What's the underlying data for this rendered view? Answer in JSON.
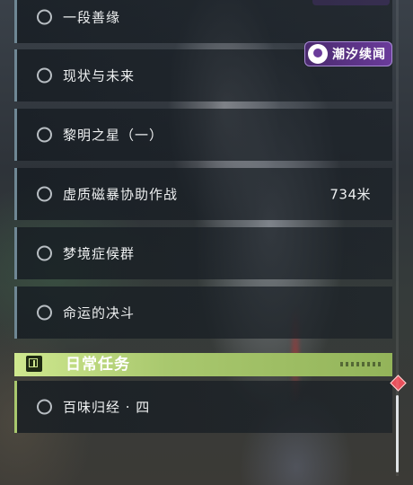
{
  "quests": [
    {
      "label": "一段善缘",
      "distance": ""
    },
    {
      "label": "现状与未来",
      "distance": ""
    },
    {
      "label": "黎明之星（一）",
      "distance": ""
    },
    {
      "label": "虚质磁暴协助作战",
      "distance": "734米"
    },
    {
      "label": "梦境症候群",
      "distance": ""
    },
    {
      "label": "命运的决斗",
      "distance": ""
    }
  ],
  "daily_section": {
    "title": "日常任务",
    "quests": [
      {
        "label": "百味归经 · 四"
      }
    ]
  },
  "event_badge": {
    "label": "潮汐续闻"
  },
  "icons": {
    "quest_status": "radio-circle-icon",
    "section": "quest-alert-icon",
    "tracker": "red-diamond-marker-icon",
    "badge": "wuthering-waves-logo-icon"
  },
  "colors": {
    "section_accent": "#a9c86e",
    "badge_bg": "#5a3388",
    "tracker_marker": "#e8505b"
  }
}
